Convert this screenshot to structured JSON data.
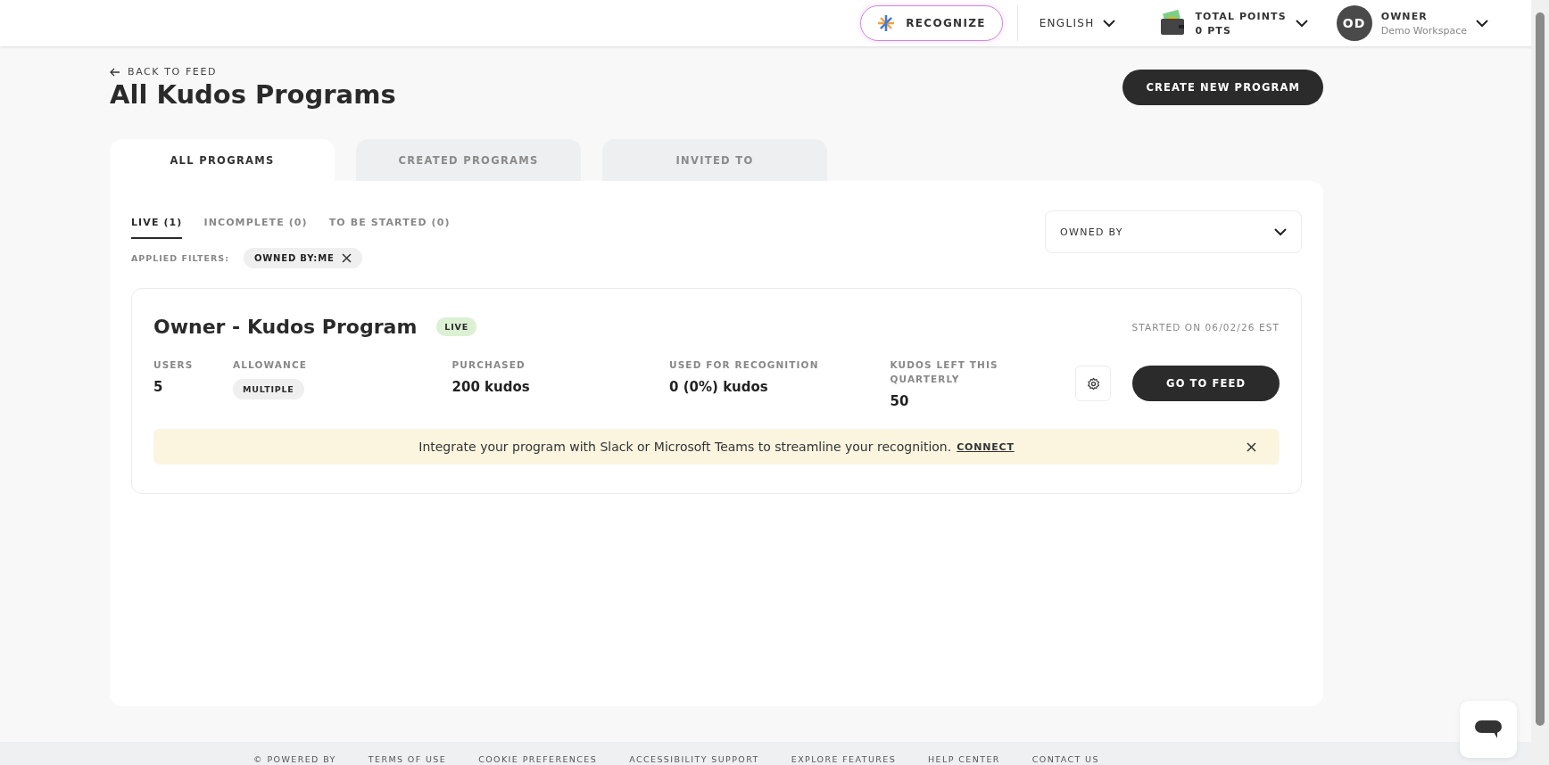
{
  "topbar": {
    "recognize": "RECOGNIZE",
    "language": "ENGLISH",
    "points_label": "TOTAL POINTS",
    "points_value": "0 PTS",
    "user_initials": "OD",
    "user_name": "OWNER",
    "user_workspace": "Demo Workspace"
  },
  "back_link": "BACK TO FEED",
  "title": "All Kudos Programs",
  "create_button": "CREATE NEW PROGRAM",
  "tabs": [
    {
      "label": "ALL PROGRAMS",
      "selected": true
    },
    {
      "label": "CREATED PROGRAMS",
      "selected": false
    },
    {
      "label": "INVITED TO",
      "selected": false
    }
  ],
  "subtabs": [
    {
      "label": "LIVE (1)",
      "selected": true
    },
    {
      "label": "INCOMPLETE (0)",
      "selected": false
    },
    {
      "label": "TO BE STARTED (0)",
      "selected": false
    }
  ],
  "owned_by": {
    "placeholder": "OWNED BY"
  },
  "applied_filters": {
    "label": "APPLIED FILTERS:",
    "chips": [
      "OWNED BY:ME"
    ]
  },
  "programs": [
    {
      "name": "Owner - Kudos Program",
      "status": "LIVE",
      "started": "STARTED ON 06/02/26 EST",
      "stats": [
        {
          "label": "USERS",
          "value": "5",
          "kind": "text"
        },
        {
          "label": "ALLOWANCE",
          "value": "MULTIPLE",
          "kind": "chip"
        },
        {
          "label": "PURCHASED",
          "value": "200 kudos",
          "kind": "text"
        },
        {
          "label": "USED FOR RECOGNITION",
          "value": "0 (0%) kudos",
          "kind": "text"
        },
        {
          "label": "KUDOS LEFT THIS QUARTERLY",
          "value": "50",
          "kind": "text"
        }
      ],
      "action": "GO TO FEED",
      "banner": {
        "text": "Integrate your program with Slack or Microsoft Teams to streamline your recognition.",
        "link": "CONNECT"
      }
    }
  ],
  "footer": [
    "© POWERED BY",
    "TERMS OF USE",
    "COOKIE PREFERENCES",
    "ACCESSIBILITY SUPPORT",
    "EXPLORE FEATURES",
    "HELP CENTER",
    "CONTACT US"
  ]
}
